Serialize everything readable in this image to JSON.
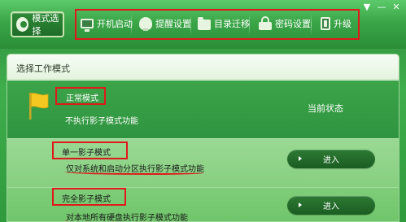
{
  "window": {
    "controls": [
      "▼",
      "—",
      "✕"
    ]
  },
  "toolbar": {
    "mode_select_label": "模式选择",
    "items": [
      {
        "label": "开机启动",
        "icon": "monitor-icon"
      },
      {
        "label": "提醒设置",
        "icon": "bulb-icon"
      },
      {
        "label": "目录迁移",
        "icon": "folder-icon"
      },
      {
        "label": "密码设置",
        "icon": "lock-icon"
      },
      {
        "label": "升级",
        "icon": "upgrade-icon"
      }
    ]
  },
  "panel": {
    "title": "选择工作模式",
    "status_label": "当前状态",
    "modes": [
      {
        "title": "正常模式",
        "desc": "不执行影子模式功能",
        "current": true
      },
      {
        "title": "单一影子模式",
        "desc": "仅对系统和启动分区执行影子模式功能",
        "button": "进入"
      },
      {
        "title": "完全影子模式",
        "desc": "对本地所有硬盘执行影子模式功能",
        "button": "进入"
      }
    ]
  },
  "colors": {
    "accent_green": "#2f9440",
    "highlight_red": "#e0181a",
    "flag_yellow": "#f4c820"
  }
}
